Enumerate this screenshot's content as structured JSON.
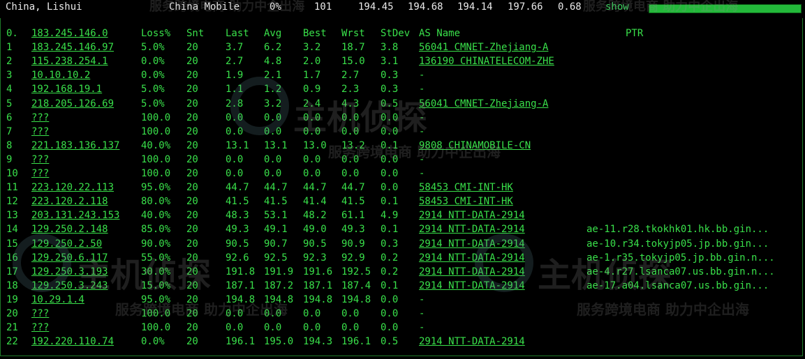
{
  "header": {
    "location": "China, Lishui",
    "isp": "China Mobile",
    "loss": "0%",
    "sent": "101",
    "last": "194.45",
    "avg": "194.68",
    "best": "194.14",
    "worst": "197.66",
    "stdev": "0.68",
    "show_link": "show",
    "progress": 1.0
  },
  "columns": [
    "Loss%",
    "Snt",
    "Last",
    "Avg",
    "Best",
    "Wrst",
    "StDev",
    "AS Name",
    "PTR"
  ],
  "hops": [
    {
      "num": "0.",
      "host": "183.245.146.0",
      "loss": "",
      "snt": "",
      "last": "",
      "avg": "",
      "best": "",
      "wrst": "",
      "stdev": "",
      "as": "",
      "ptr": ""
    },
    {
      "num": "1",
      "host": "183.245.146.97",
      "loss": "5.0%",
      "snt": "20",
      "last": "3.7",
      "avg": "6.2",
      "best": "3.2",
      "wrst": "18.7",
      "stdev": "3.8",
      "as": "56041  CMNET-Zhejiang-A",
      "ptr": ""
    },
    {
      "num": "2",
      "host": "115.238.254.1",
      "loss": "0.0%",
      "snt": "20",
      "last": "2.7",
      "avg": "4.8",
      "best": "2.0",
      "wrst": "15.0",
      "stdev": "3.1",
      "as": "136190  CHINATELECOM-ZHE",
      "ptr": ""
    },
    {
      "num": "3",
      "host": "10.10.10.2",
      "loss": "0.0%",
      "snt": "20",
      "last": "1.9",
      "avg": "2.1",
      "best": "1.7",
      "wrst": "2.7",
      "stdev": "0.3",
      "as": "-",
      "ptr": ""
    },
    {
      "num": "4",
      "host": "192.168.19.1",
      "loss": "5.0%",
      "snt": "20",
      "last": "1.1",
      "avg": "1.2",
      "best": "0.9",
      "wrst": "2.3",
      "stdev": "0.3",
      "as": "-",
      "ptr": ""
    },
    {
      "num": "5",
      "host": "218.205.126.69",
      "loss": "5.0%",
      "snt": "20",
      "last": "2.8",
      "avg": "3.2",
      "best": "2.4",
      "wrst": "4.3",
      "stdev": "0.5",
      "as": "56041  CMNET-Zhejiang-A",
      "ptr": ""
    },
    {
      "num": "6",
      "host": "???",
      "loss": "100.0",
      "snt": "20",
      "last": "0.0",
      "avg": "0.0",
      "best": "0.0",
      "wrst": "0.0",
      "stdev": "0.0",
      "as": "-",
      "ptr": ""
    },
    {
      "num": "7",
      "host": "???",
      "loss": "100.0",
      "snt": "20",
      "last": "0.0",
      "avg": "0.0",
      "best": "0.0",
      "wrst": "0.0",
      "stdev": "0.0",
      "as": "-",
      "ptr": ""
    },
    {
      "num": "8",
      "host": "221.183.136.137",
      "loss": "40.0%",
      "snt": "20",
      "last": "13.1",
      "avg": "13.1",
      "best": "13.0",
      "wrst": "13.2",
      "stdev": "0.1",
      "as": "9808  CHINAMOBILE-CN",
      "ptr": ""
    },
    {
      "num": "9",
      "host": "???",
      "loss": "100.0",
      "snt": "20",
      "last": "0.0",
      "avg": "0.0",
      "best": "0.0",
      "wrst": "0.0",
      "stdev": "0.0",
      "as": "-",
      "ptr": ""
    },
    {
      "num": "10",
      "host": "???",
      "loss": "100.0",
      "snt": "20",
      "last": "0.0",
      "avg": "0.0",
      "best": "0.0",
      "wrst": "0.0",
      "stdev": "0.0",
      "as": "-",
      "ptr": ""
    },
    {
      "num": "11",
      "host": "223.120.22.113",
      "loss": "95.0%",
      "snt": "20",
      "last": "44.7",
      "avg": "44.7",
      "best": "44.7",
      "wrst": "44.7",
      "stdev": "0.0",
      "as": "58453  CMI-INT-HK",
      "ptr": ""
    },
    {
      "num": "12",
      "host": "223.120.2.118",
      "loss": "80.0%",
      "snt": "20",
      "last": "41.5",
      "avg": "41.5",
      "best": "41.4",
      "wrst": "41.5",
      "stdev": "0.1",
      "as": "58453  CMI-INT-HK",
      "ptr": ""
    },
    {
      "num": "13",
      "host": "203.131.243.153",
      "loss": "40.0%",
      "snt": "20",
      "last": "48.3",
      "avg": "53.1",
      "best": "48.2",
      "wrst": "61.1",
      "stdev": "4.9",
      "as": "2914  NTT-DATA-2914",
      "ptr": ""
    },
    {
      "num": "14",
      "host": "129.250.2.148",
      "loss": "85.0%",
      "snt": "20",
      "last": "49.3",
      "avg": "49.1",
      "best": "49.0",
      "wrst": "49.3",
      "stdev": "0.1",
      "as": "2914  NTT-DATA-2914",
      "ptr": "ae-11.r28.tkokhk01.hk.bb.gin..."
    },
    {
      "num": "15",
      "host": "129.250.2.50",
      "loss": "90.0%",
      "snt": "20",
      "last": "90.5",
      "avg": "90.7",
      "best": "90.5",
      "wrst": "90.9",
      "stdev": "0.3",
      "as": "2914  NTT-DATA-2914",
      "ptr": "ae-10.r34.tokyjp05.jp.bb.gin..."
    },
    {
      "num": "16",
      "host": "129.250.6.117",
      "loss": "55.0%",
      "snt": "20",
      "last": "92.6",
      "avg": "92.5",
      "best": "92.3",
      "wrst": "92.9",
      "stdev": "0.2",
      "as": "2914  NTT-DATA-2914",
      "ptr": "ae-1.r35.tokyjp05.jp.bb.gin.n..."
    },
    {
      "num": "17",
      "host": "129.250.3.193",
      "loss": "30.0%",
      "snt": "20",
      "last": "191.8",
      "avg": "191.9",
      "best": "191.6",
      "wrst": "192.5",
      "stdev": "0.2",
      "as": "2914  NTT-DATA-2914",
      "ptr": "ae-4.r27.lsanca07.us.bb.gin.n..."
    },
    {
      "num": "18",
      "host": "129.250.3.243",
      "loss": "15.0%",
      "snt": "20",
      "last": "187.1",
      "avg": "187.2",
      "best": "187.1",
      "wrst": "187.4",
      "stdev": "0.1",
      "as": "2914  NTT-DATA-2914",
      "ptr": "ae-17.a04.lsanca07.us.bb.gin..."
    },
    {
      "num": "19",
      "host": "10.29.1.4",
      "loss": "95.0%",
      "snt": "20",
      "last": "194.8",
      "avg": "194.8",
      "best": "194.8",
      "wrst": "194.8",
      "stdev": "0.0",
      "as": "-",
      "ptr": ""
    },
    {
      "num": "20",
      "host": "???",
      "loss": "100.0",
      "snt": "20",
      "last": "0.0",
      "avg": "0.0",
      "best": "0.0",
      "wrst": "0.0",
      "stdev": "0.0",
      "as": "-",
      "ptr": ""
    },
    {
      "num": "21",
      "host": "???",
      "loss": "100.0",
      "snt": "20",
      "last": "0.0",
      "avg": "0.0",
      "best": "0.0",
      "wrst": "0.0",
      "stdev": "0.0",
      "as": "-",
      "ptr": ""
    },
    {
      "num": "22",
      "host": "192.220.110.74",
      "loss": "0.0%",
      "snt": "20",
      "last": "196.1",
      "avg": "195.0",
      "best": "194.3",
      "wrst": "196.1",
      "stdev": "0.5",
      "as": "2914  NTT-DATA-2914",
      "ptr": ""
    }
  ],
  "watermark": {
    "brand": "主机侦探",
    "tagline": "服务跨境电商 助力中企出海"
  },
  "colors": {
    "terminal_text": "#39e04a",
    "background": "#000000",
    "header_text": "#eaeaea",
    "progress": "#23b93a"
  }
}
